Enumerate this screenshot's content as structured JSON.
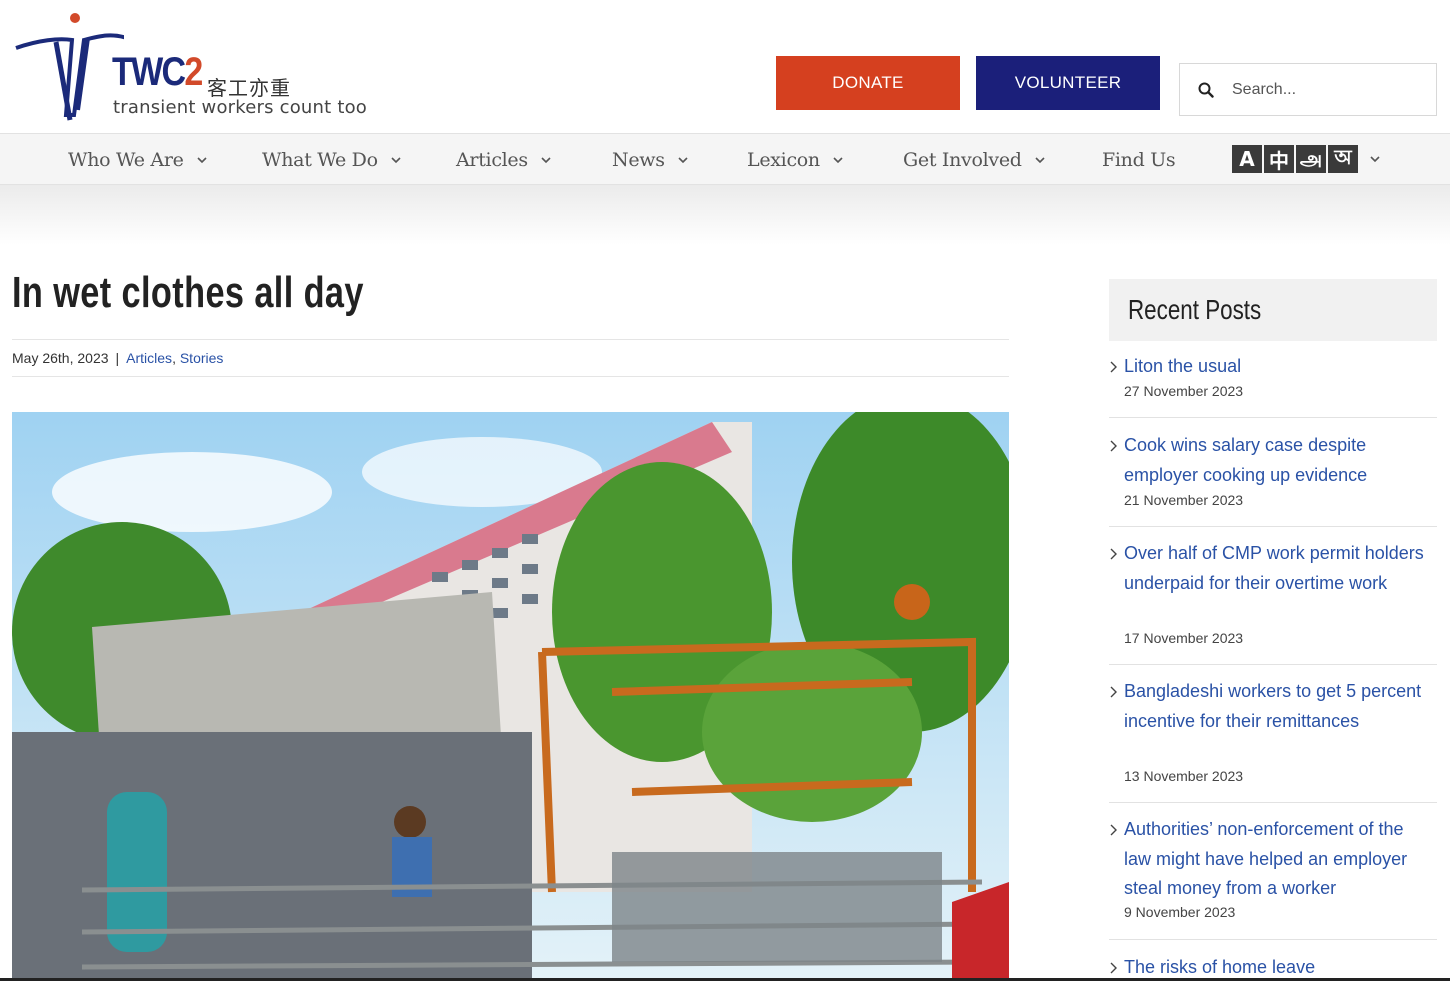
{
  "header": {
    "logo": {
      "brand_main": "TWC",
      "brand_num": "2",
      "brand_cjk": "客工亦重",
      "tagline": "transient workers count too"
    },
    "donate_label": "DONATE",
    "volunteer_label": "VOLUNTEER",
    "search_placeholder": "Search...",
    "colors": {
      "donate": "#d5401f",
      "volunteer": "#1b1f7a",
      "link": "#2a52a6"
    }
  },
  "nav": {
    "items": [
      {
        "label": "Who We Are",
        "has_dropdown": true
      },
      {
        "label": "What We Do",
        "has_dropdown": true
      },
      {
        "label": "Articles",
        "has_dropdown": true
      },
      {
        "label": "News",
        "has_dropdown": true
      },
      {
        "label": "Lexicon",
        "has_dropdown": true
      },
      {
        "label": "Get Involved",
        "has_dropdown": true
      },
      {
        "label": "Find Us",
        "has_dropdown": false
      }
    ],
    "language_glyphs": [
      "A",
      "中",
      "அ",
      "অ"
    ]
  },
  "article": {
    "title": "In wet clothes all day",
    "date": "May 26th, 2023",
    "separator": "|",
    "categories": [
      "Articles",
      "Stories"
    ],
    "category_joiner": ","
  },
  "sidebar": {
    "heading": "Recent Posts",
    "posts": [
      {
        "title": "Liton the usual",
        "date": "27 November 2023"
      },
      {
        "title": "Cook wins salary case despite employer cooking up evidence",
        "date": "21 November 2023"
      },
      {
        "title": "Over half of CMP work permit holders underpaid for their overtime work",
        "date": "17 November 2023"
      },
      {
        "title": "Bangladeshi workers to get 5 percent incentive for their remittances",
        "date": "13 November 2023"
      },
      {
        "title": "Authorities’ non-enforcement of the law might have helped an employer steal money from a worker",
        "date": "9 November 2023"
      },
      {
        "title": "The risks of home leave",
        "date": ""
      }
    ]
  }
}
